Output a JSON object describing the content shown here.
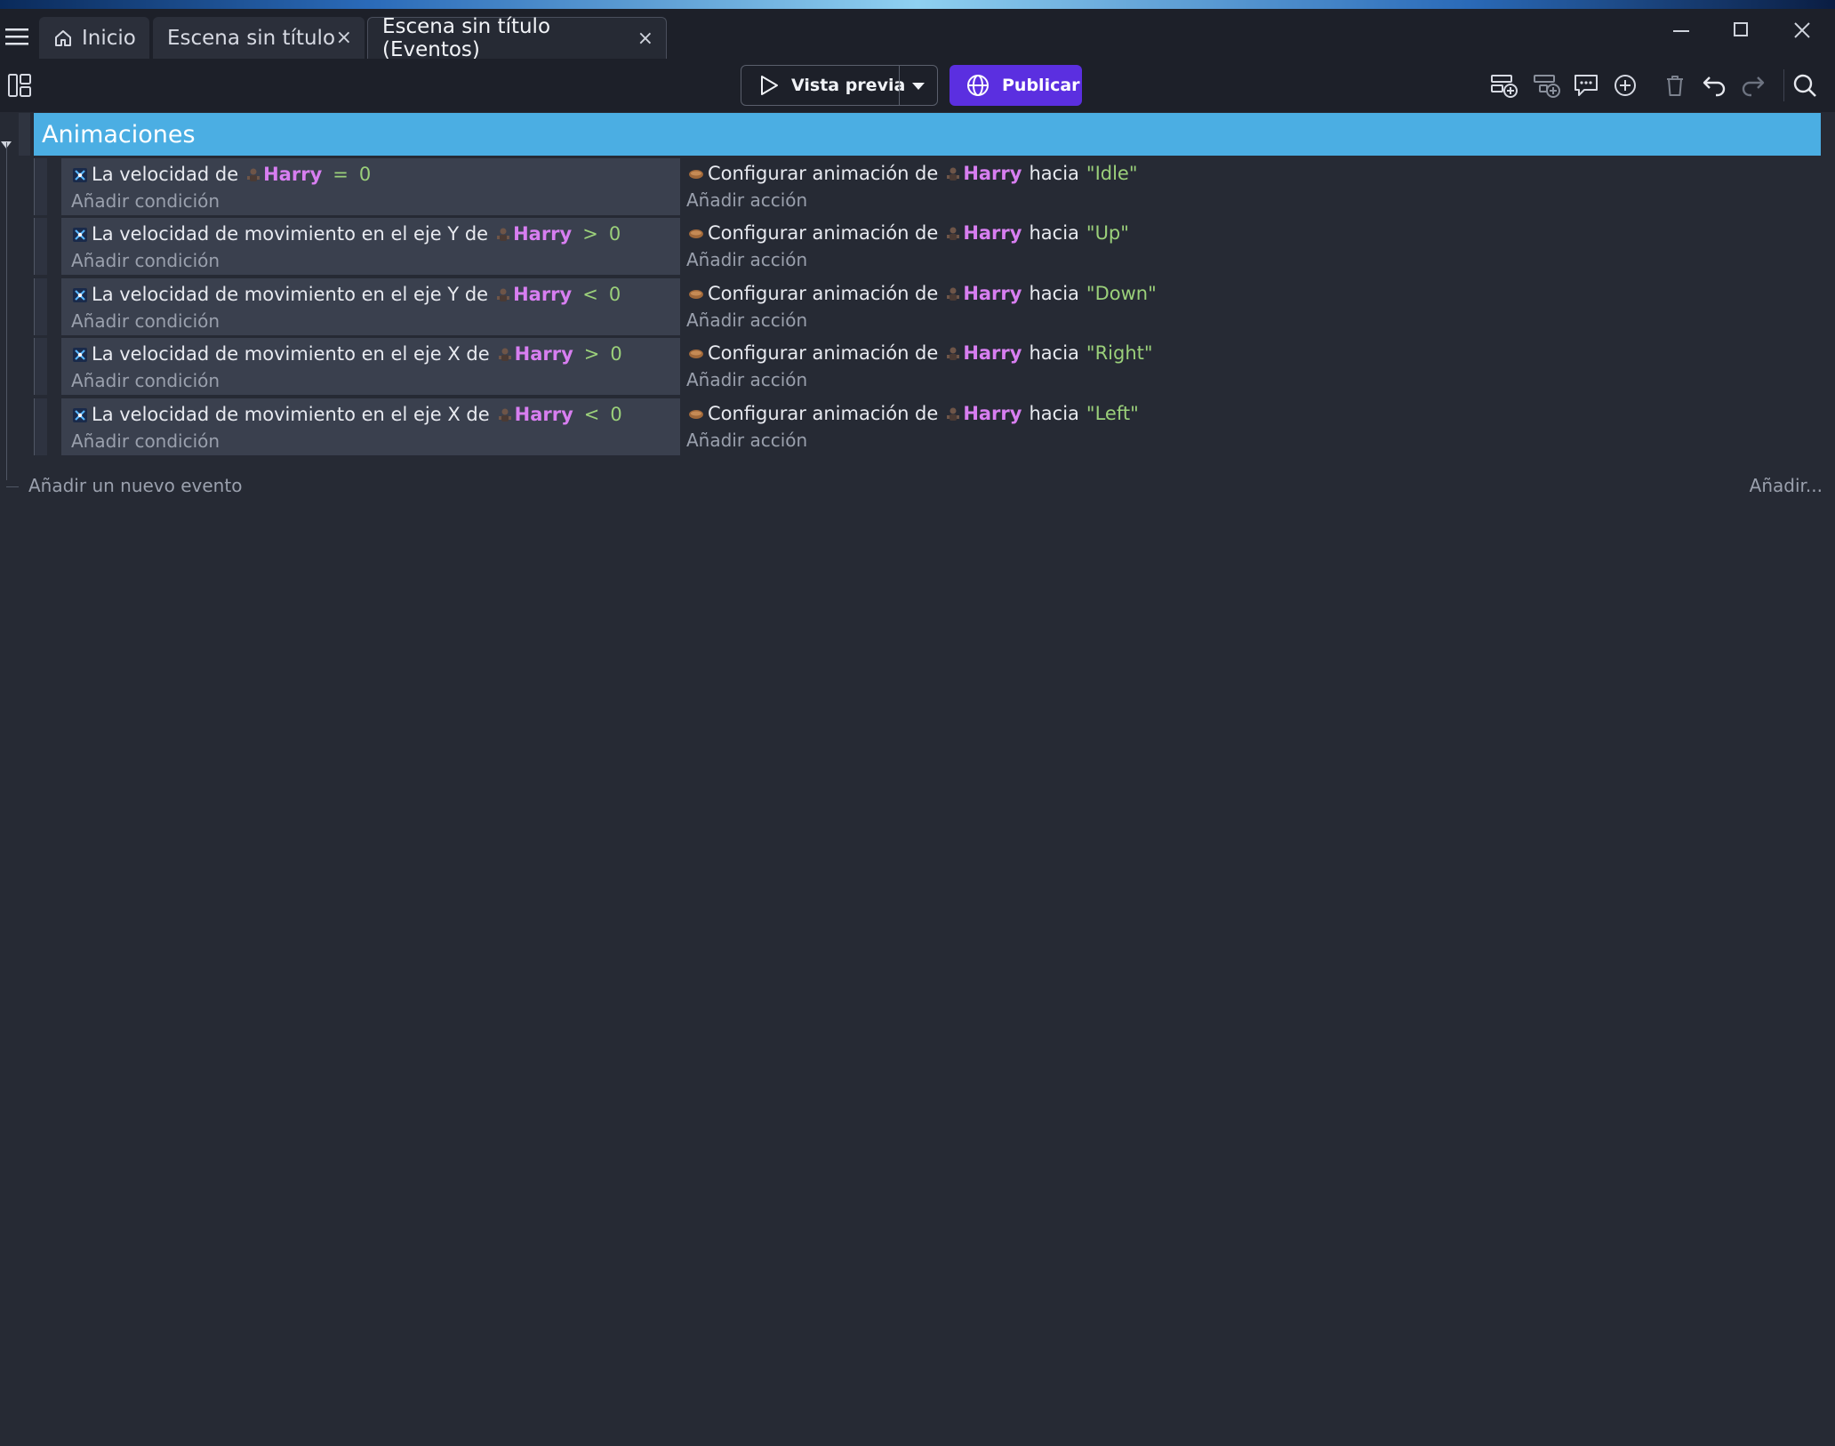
{
  "tabs": [
    {
      "label": "Inicio",
      "icon": "home-icon"
    },
    {
      "label": "Escena sin título",
      "close": "×"
    },
    {
      "label": "Escena sin título (Eventos)",
      "close": "×"
    }
  ],
  "toolbar": {
    "preview_label": "Vista previa",
    "publish_label": "Publicar"
  },
  "colors": {
    "group_header": "#4baee3",
    "publish": "#5b2fe0",
    "object_name": "#d77ef0",
    "value": "#9bd07a"
  },
  "group": {
    "title": "Animaciones"
  },
  "events": [
    {
      "cond_pre": "La velocidad de",
      "object": "Harry",
      "op": "=",
      "value": "0",
      "action_pre": "Configurar animación de",
      "action_object": "Harry",
      "action_mid": "hacia",
      "action_value": "\"Idle\""
    },
    {
      "cond_pre": "La velocidad de movimiento en el eje Y de",
      "object": "Harry",
      "op": ">",
      "value": "0",
      "action_pre": "Configurar animación de",
      "action_object": "Harry",
      "action_mid": "hacia",
      "action_value": "\"Up\""
    },
    {
      "cond_pre": "La velocidad de movimiento en el eje Y de",
      "object": "Harry",
      "op": "<",
      "value": "0",
      "action_pre": "Configurar animación de",
      "action_object": "Harry",
      "action_mid": "hacia",
      "action_value": "\"Down\""
    },
    {
      "cond_pre": "La velocidad de movimiento en el eje X de",
      "object": "Harry",
      "op": ">",
      "value": "0",
      "action_pre": "Configurar animación de",
      "action_object": "Harry",
      "action_mid": "hacia",
      "action_value": "\"Right\""
    },
    {
      "cond_pre": "La velocidad de movimiento en el eje X de",
      "object": "Harry",
      "op": "<",
      "value": "0",
      "action_pre": "Configurar animación de",
      "action_object": "Harry",
      "action_mid": "hacia",
      "action_value": "\"Left\""
    }
  ],
  "labels": {
    "add_condition": "Añadir condición",
    "add_action": "Añadir acción",
    "add_event": "Añadir un nuevo evento",
    "add_more": "Añadir..."
  }
}
